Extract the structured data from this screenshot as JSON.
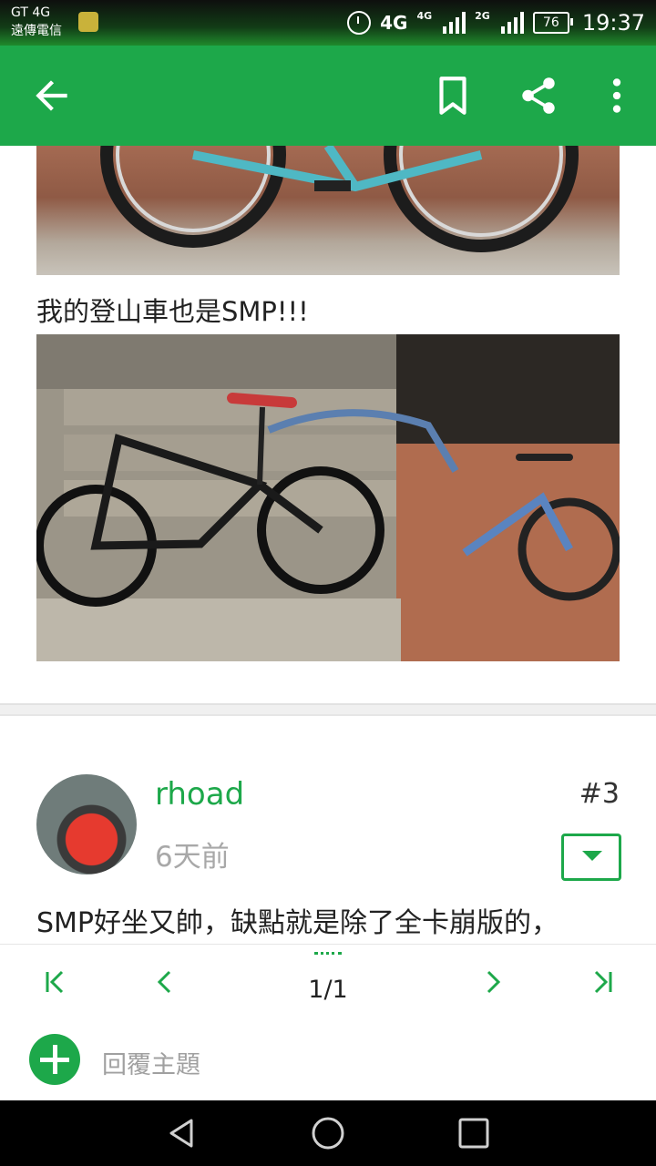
{
  "status_bar": {
    "carrier_line1": "GT 4G",
    "carrier_line2": "遠傳電信",
    "network1": "4G",
    "network2": "4G",
    "network3": "2G",
    "battery": "76",
    "time": "19:37"
  },
  "app_bar": {
    "icons": [
      "back-icon",
      "bookmark-icon",
      "share-icon",
      "more-icon"
    ]
  },
  "post_prev": {
    "caption": "我的登山車也是SMP!!!"
  },
  "post": {
    "username": "rhoad",
    "time": "6天前",
    "number": "#3",
    "body": "SMP好坐又帥，缺點就是除了全卡崩版的，"
  },
  "pager": {
    "indicator": "1/1"
  },
  "reply": {
    "placeholder": "回覆主題"
  },
  "colors": {
    "accent": "#1da84a",
    "status_bar": "#0e0f0e",
    "nav_bar": "#000000"
  }
}
